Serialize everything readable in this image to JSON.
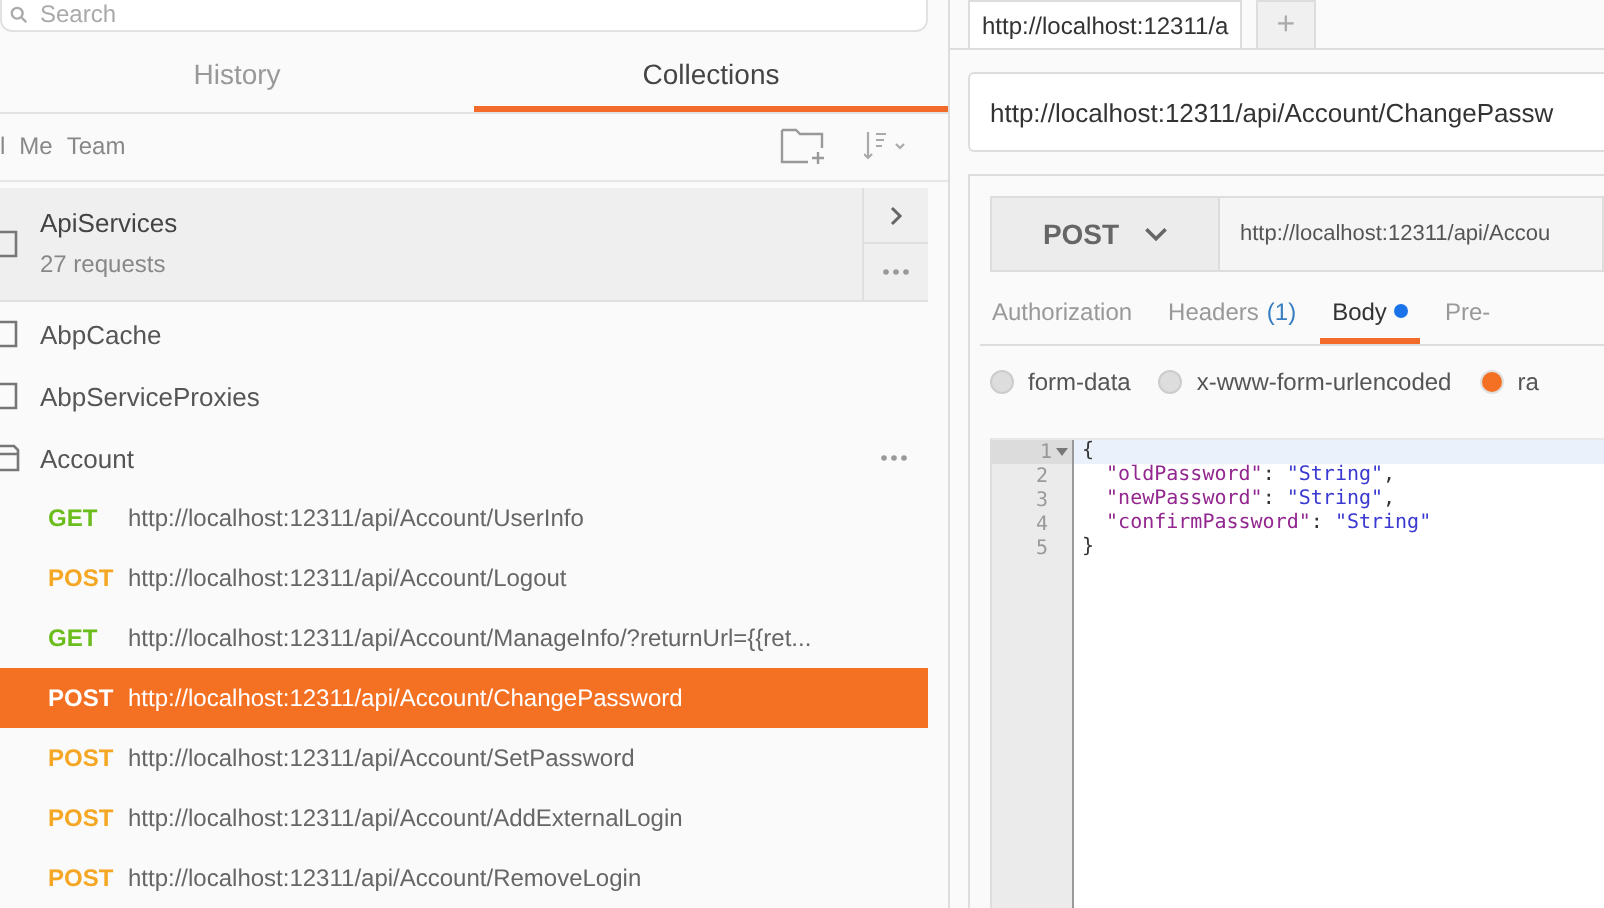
{
  "search": {
    "placeholder": "Search"
  },
  "sidebar_tabs": [
    {
      "label": "History",
      "selected": false
    },
    {
      "label": "Collections",
      "selected": true
    }
  ],
  "filters": [
    {
      "label": "l",
      "selected": false
    },
    {
      "label": "Me",
      "selected": false
    },
    {
      "label": "Team",
      "selected": false
    }
  ],
  "collections": [
    {
      "kind": "card",
      "name": "ApiServices",
      "subtitle": "27 requests",
      "expanded": false
    },
    {
      "kind": "folder",
      "name": "AbpCache",
      "expanded": false
    },
    {
      "kind": "folder",
      "name": "AbpServiceProxies",
      "expanded": false
    },
    {
      "kind": "folder",
      "name": "Account",
      "expanded": true,
      "children": [
        {
          "method": "GET",
          "kind": "get",
          "url": "http://localhost:12311/api/Account/UserInfo",
          "selected": false
        },
        {
          "method": "POST",
          "kind": "post",
          "url": "http://localhost:12311/api/Account/Logout",
          "selected": false
        },
        {
          "method": "GET",
          "kind": "get",
          "url": "http://localhost:12311/api/Account/ManageInfo/?returnUrl={{ret...",
          "selected": false
        },
        {
          "method": "POST",
          "kind": "post",
          "url": "http://localhost:12311/api/Account/ChangePassword",
          "selected": true
        },
        {
          "method": "POST",
          "kind": "post",
          "url": "http://localhost:12311/api/Account/SetPassword",
          "selected": false
        },
        {
          "method": "POST",
          "kind": "post",
          "url": "http://localhost:12311/api/Account/AddExternalLogin",
          "selected": false
        },
        {
          "method": "POST",
          "kind": "post",
          "url": "http://localhost:12311/api/Account/RemoveLogin",
          "selected": false
        }
      ]
    }
  ],
  "request_tabs": [
    {
      "kind": "tab",
      "label": "http://localhost:12311/a",
      "selected": true
    },
    {
      "kind": "add",
      "label": "+",
      "selected": false
    }
  ],
  "request_title": "http://localhost:12311/api/Account/ChangePassw",
  "method": "POST",
  "url": "http://localhost:12311/api/Accou",
  "section_tabs": [
    {
      "label": "Authorization",
      "dot": false,
      "selected": false
    },
    {
      "label": "Headers",
      "count": "(1)",
      "dot": false,
      "selected": false
    },
    {
      "label": "Body",
      "dot": true,
      "selected": true
    },
    {
      "label": "Pre-",
      "dot": false,
      "selected": false
    }
  ],
  "body_types": [
    {
      "label": "form-data",
      "selected": false
    },
    {
      "label": "x-www-form-urlencoded",
      "selected": false
    },
    {
      "label": "ra",
      "selected": true
    }
  ],
  "code_lines": [
    {
      "number": "1",
      "fold": true,
      "active": true,
      "tokens": [
        {
          "kind": "punct",
          "text": "{"
        }
      ]
    },
    {
      "number": "2",
      "fold": false,
      "active": false,
      "tokens": [
        {
          "kind": "key",
          "text": "  \"oldPassword\""
        },
        {
          "kind": "punct",
          "text": ": "
        },
        {
          "kind": "string",
          "text": "\"String\""
        },
        {
          "kind": "punct",
          "text": ","
        }
      ]
    },
    {
      "number": "3",
      "fold": false,
      "active": false,
      "tokens": [
        {
          "kind": "key",
          "text": "  \"newPassword\""
        },
        {
          "kind": "punct",
          "text": ": "
        },
        {
          "kind": "string",
          "text": "\"String\""
        },
        {
          "kind": "punct",
          "text": ","
        }
      ]
    },
    {
      "number": "4",
      "fold": false,
      "active": false,
      "tokens": [
        {
          "kind": "key",
          "text": "  \"confirmPassword\""
        },
        {
          "kind": "punct",
          "text": ": "
        },
        {
          "kind": "string",
          "text": "\"String\""
        }
      ]
    },
    {
      "number": "5",
      "fold": false,
      "active": false,
      "tokens": [
        {
          "kind": "punct",
          "text": "}"
        }
      ]
    }
  ]
}
